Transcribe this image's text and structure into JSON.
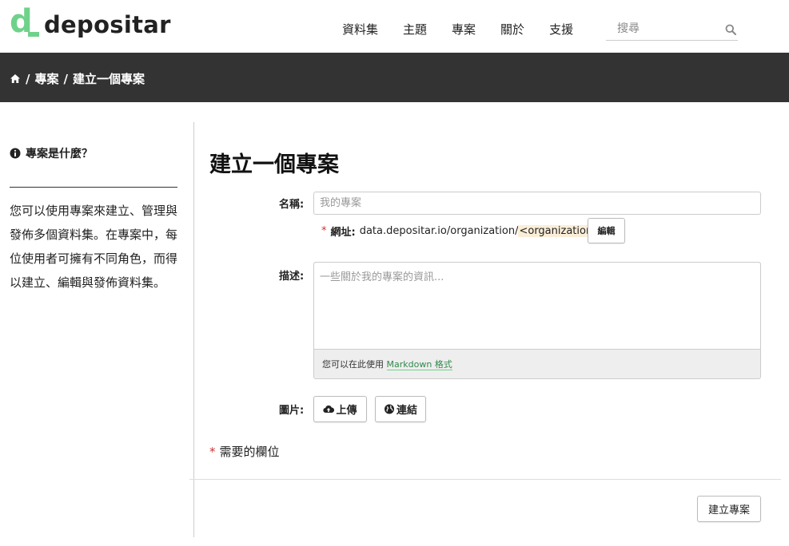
{
  "header": {
    "logo_text": "depositar",
    "nav": [
      "資料集",
      "主題",
      "專案",
      "關於",
      "支援"
    ],
    "search_placeholder": "搜尋"
  },
  "breadcrumb": {
    "items": [
      "專案",
      "建立一個專案"
    ]
  },
  "sidebar": {
    "title": "專案是什麼？",
    "body": "您可以使用專案來建立、管理與發佈多個資料集。在專案中，每位使用者可擁有不同角色，而得以建立、編輯與發佈資料集。"
  },
  "form": {
    "page_title": "建立一個專案",
    "name_label": "名稱:",
    "name_placeholder": "我的專案",
    "url_required_mark": "*",
    "url_label": "網址:",
    "url_prefix": "data.depositar.io/organization/",
    "url_slug": "<organization>",
    "edit_label": "編輯",
    "desc_label": "描述:",
    "desc_placeholder": "一些關於我的專案的資訊...",
    "md_help_prefix": "您可以在此使用",
    "md_help_link": "Markdown 格式",
    "image_label": "圖片:",
    "upload_label": "上傳",
    "link_label": "連結",
    "required_mark": "*",
    "required_note": "需要的欄位",
    "submit_label": "建立專案"
  },
  "colors": {
    "brand_green": "#6fd28a",
    "band": "#333333",
    "required": "#cc3333"
  }
}
